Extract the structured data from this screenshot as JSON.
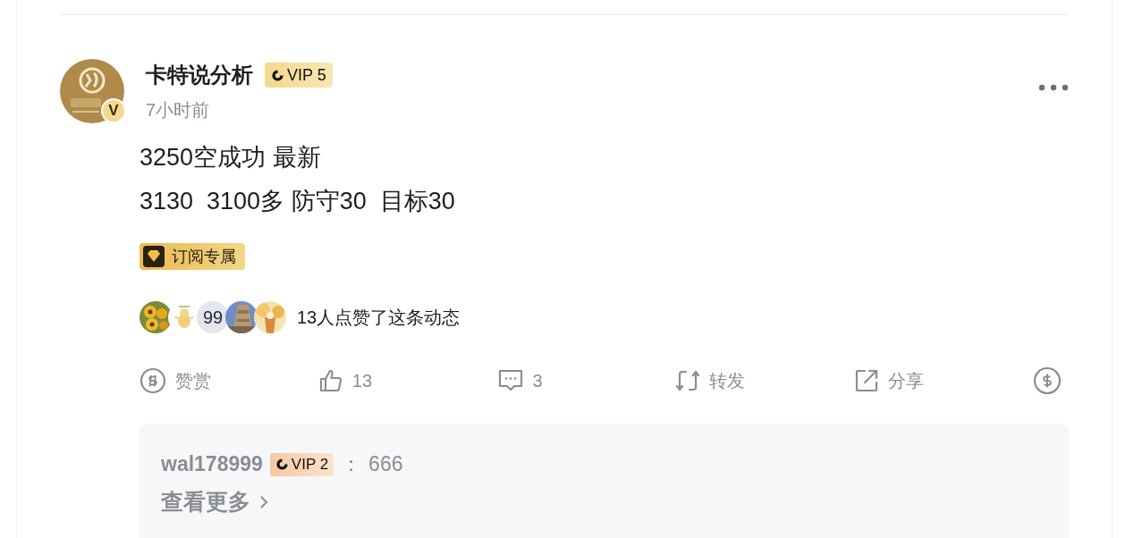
{
  "author": {
    "name": "卡特说分析",
    "vip": "VIP 5",
    "verified_badge": "V",
    "time": "7小时前"
  },
  "content": [
    "3250空成功 最新",
    "3130  3100多 防守30  目标30"
  ],
  "tag": "订阅专属",
  "likes": {
    "avatars": [
      {
        "kind": "picture"
      },
      {
        "kind": "picture"
      },
      {
        "kind": "count",
        "text": "99"
      },
      {
        "kind": "picture"
      },
      {
        "kind": "picture"
      }
    ],
    "summary": "13人点赞了这条动态"
  },
  "actions": [
    {
      "kind": "reward",
      "label": "赞赏"
    },
    {
      "kind": "like",
      "label": "13"
    },
    {
      "kind": "comment",
      "label": "3"
    },
    {
      "kind": "repost",
      "label": "转发"
    },
    {
      "kind": "share",
      "label": "分享"
    },
    {
      "kind": "tip"
    }
  ],
  "comments": [
    {
      "user": "wal178999",
      "vip": "VIP 2",
      "separator": "：",
      "text": "666"
    }
  ],
  "more": "查看更多"
}
